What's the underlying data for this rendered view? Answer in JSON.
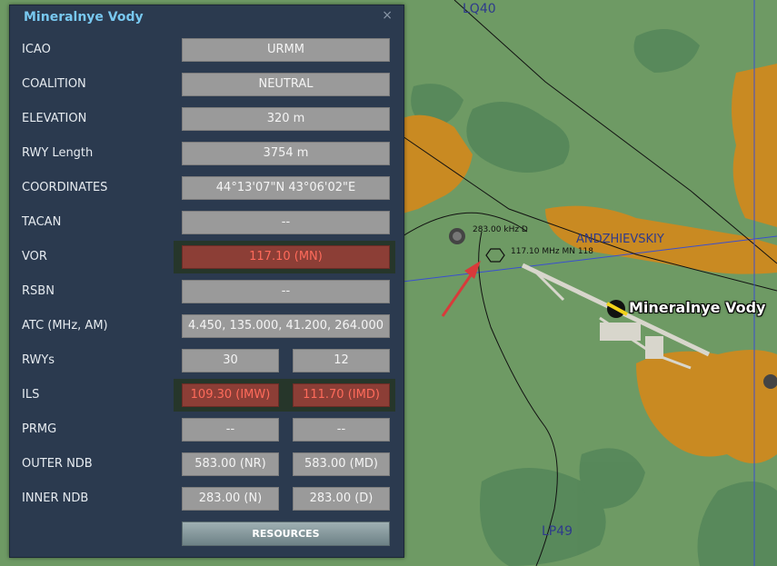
{
  "panel": {
    "title": "Mineralnye Vody",
    "close_label": "×",
    "resources_label": "RESOURCES"
  },
  "rows": [
    {
      "label": "ICAO",
      "values": [
        "URMM"
      ]
    },
    {
      "label": "COALITION",
      "values": [
        "NEUTRAL"
      ]
    },
    {
      "label": "ELEVATION",
      "values": [
        "320 m"
      ]
    },
    {
      "label": "RWY Length",
      "values": [
        "3754 m"
      ]
    },
    {
      "label": "COORDINATES",
      "values": [
        "44°13'07\"N 43°06'02\"E"
      ]
    },
    {
      "label": "TACAN",
      "values": [
        "--"
      ]
    },
    {
      "label": "VOR",
      "values": [
        "117.10 (MN)"
      ],
      "alert": true
    },
    {
      "label": "RSBN",
      "values": [
        "--"
      ]
    },
    {
      "label": "ATC  (MHz, AM)",
      "values": [
        "4.450, 135.000, 41.200, 264.000"
      ]
    },
    {
      "label": "RWYs",
      "values": [
        "30",
        "12"
      ]
    },
    {
      "label": "ILS",
      "values": [
        "109.30 (IMW)",
        "111.70 (IMD)"
      ],
      "alert": true
    },
    {
      "label": "PRMG",
      "values": [
        "--",
        "--"
      ]
    },
    {
      "label": "OUTER NDB",
      "values": [
        "583.00 (NR)",
        "583.00 (MD)"
      ]
    },
    {
      "label": "INNER NDB",
      "values": [
        "283.00 (N)",
        "283.00 (D)"
      ]
    }
  ],
  "map": {
    "grid_top": "LQ40",
    "grid_bottom": "LP49",
    "town": "ANDZHIEVSKIY",
    "ndb_label": "283.00 kHz D",
    "vor_label": "117.10 MHz MN 118",
    "airfield_name": "Mineralnye Vody",
    "colors": {
      "terrain": "#6e9a64",
      "forest": "#4f7d52",
      "urban": "#c98a22",
      "alert": "#8c3e36",
      "title": "#78c8f0"
    }
  }
}
